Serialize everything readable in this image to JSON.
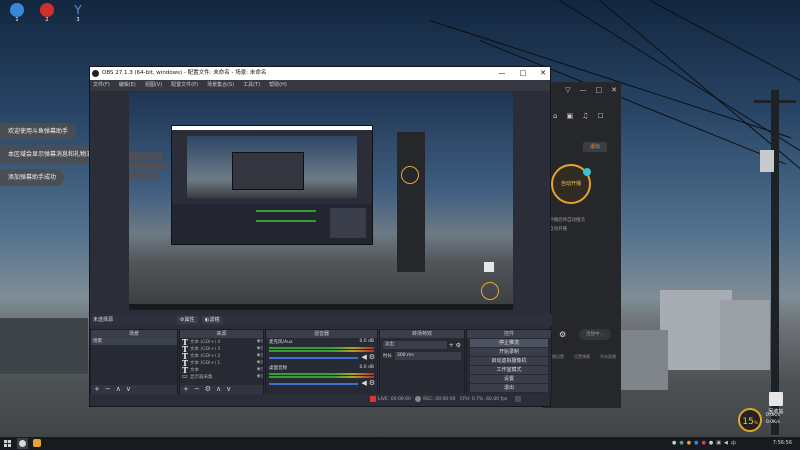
{
  "desktop_icons": [
    {
      "label": "1",
      "icon": "search-icon",
      "color": "#3a86d6"
    },
    {
      "label": "2",
      "icon": "no-entry-icon",
      "color": "#d0302b"
    },
    {
      "label": "3",
      "icon": "antenna-icon",
      "color": "#5a8fd6"
    }
  ],
  "notifications": [
    "欢迎使用斗鱼弹幕助手",
    "本区域会显示弹幕消息和礼物消息",
    "添加弹幕助手成功"
  ],
  "helper": {
    "logout": "退出",
    "auto_start": "自动开播",
    "hint_lines": [
      "开播后将自动推流",
      "自动开播"
    ],
    "connect": "连接中...",
    "footer": [
      "开播设置",
      "设置弹幕",
      "开启直播"
    ]
  },
  "obs": {
    "title": "OBS 27.1.3 (64-bit, windows) - 配置文件: 未命名 - 场景: 未命名",
    "menu": [
      "文件(F)",
      "编辑(E)",
      "视图(V)",
      "配置文件(P)",
      "场景集合(S)",
      "工具(T)",
      "帮助(H)"
    ],
    "no_source": "未选择源",
    "props_btn": "属性",
    "filter_btn": "滤镜",
    "docks": {
      "scenes": {
        "title": "场景",
        "items": [
          "场景"
        ]
      },
      "sources": {
        "title": "来源",
        "items": [
          "文本 (GDI+) 4",
          "文本 (GDI+) 3",
          "文本 (GDI+) 2",
          "文本 (GDI+) 1",
          "文本",
          "显示器采集"
        ]
      },
      "mixer": {
        "title": "混音器",
        "channels": [
          {
            "name": "麦克风/Aux",
            "db": "0.0 dB"
          },
          {
            "name": "桌面音频",
            "db": "0.0 dB"
          }
        ]
      },
      "transitions": {
        "title": "转场特效",
        "type": "淡出",
        "duration_label": "时长",
        "duration": "300 ms"
      },
      "controls": {
        "title": "控件",
        "buttons": [
          "停止推流",
          "开始录制",
          "启动虚拟摄像机",
          "工作室模式",
          "设置",
          "退出"
        ]
      }
    },
    "status": {
      "live": "LIVE: 00:00:00",
      "rec": "REC: 00:00:00",
      "cpu": "CPU: 0.7%, 60.00 fps"
    }
  },
  "desktop_widgets": {
    "perf": "15",
    "perf_unit": "%",
    "net_lines": [
      "0.0K/s",
      "0.0K/s"
    ],
    "recycle": "回收站"
  },
  "taskbar": {
    "time": "7:56:56",
    "ime": "中"
  }
}
